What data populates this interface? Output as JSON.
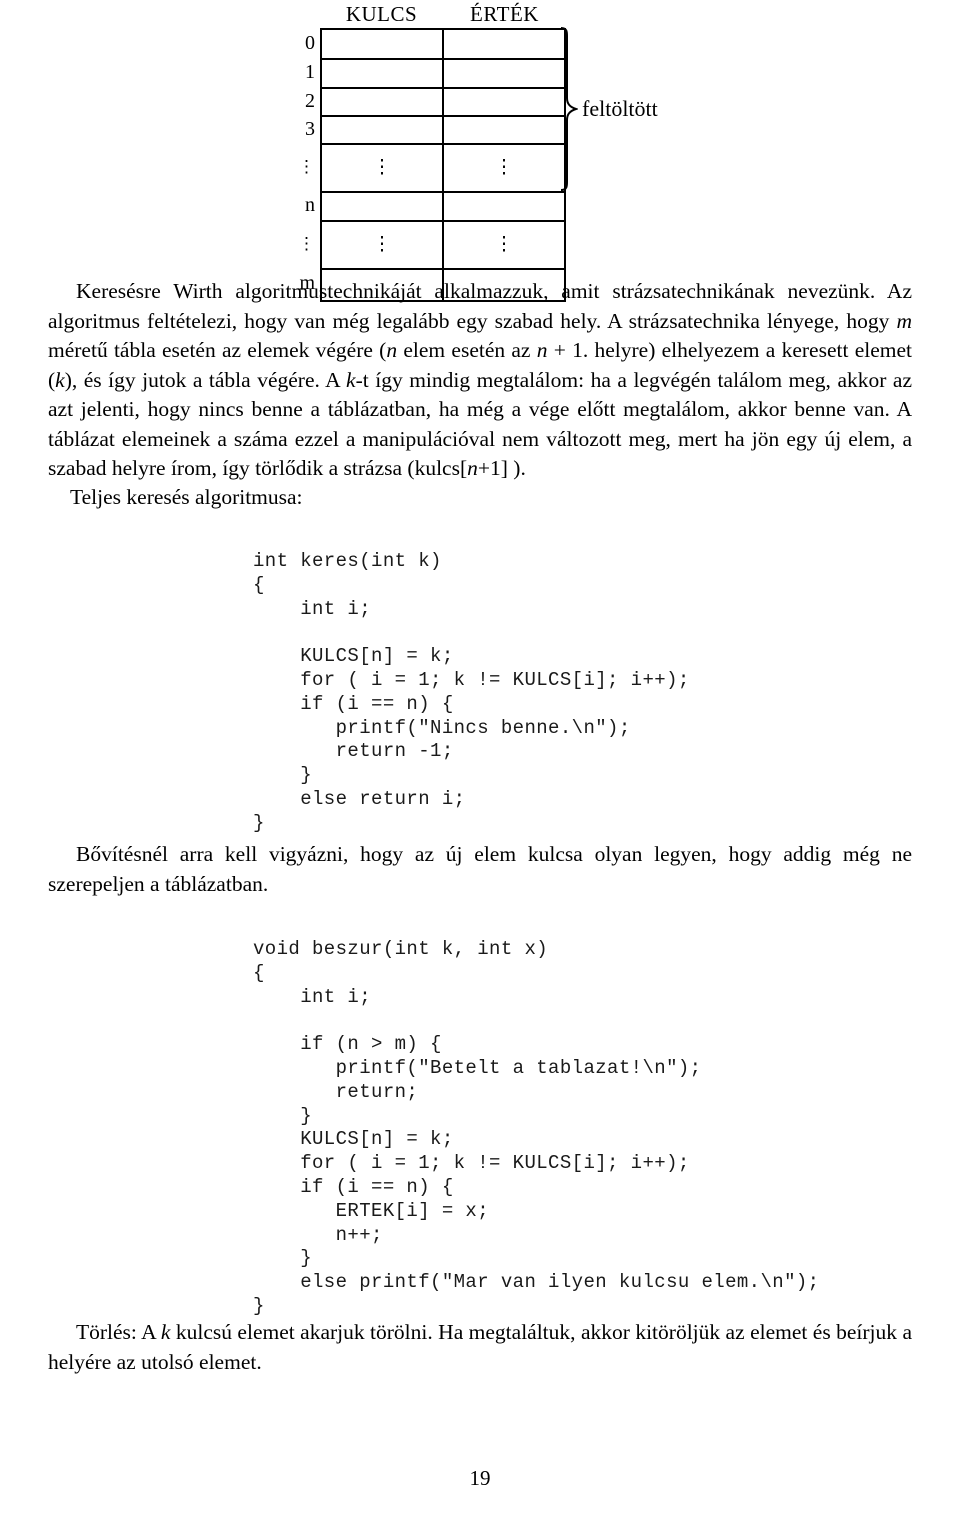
{
  "figure": {
    "column_headers": [
      "KULCS",
      "ÉRTÉK"
    ],
    "row_labels": [
      "0",
      "1",
      "2",
      "3",
      "⋮",
      "n",
      "⋮",
      "m"
    ],
    "cell_marks": [
      "",
      "",
      "",
      "",
      "⋮",
      "",
      "⋮",
      ""
    ],
    "brace_label": "feltöltött",
    "brace_icon": "right-curly-brace-icon"
  },
  "paragraphs": {
    "intro_html": "Keresésre Wirth algoritmustechnikáját alkalmazzuk, amit strázsatechnikának nevezünk. Az algoritmus feltételezi, hogy van még legalább egy szabad hely. A strázsatechnika lényege, hogy <i>m</i> méretű tábla esetén az elemek végére (<i>n</i> elem esetén az <i>n</i> + 1. helyre) elhelyezem a keresett elemet (<i>k</i>), és így jutok a tábla végére. A <i>k</i>-t így mindig megtalálom: ha a legvégén találom meg, akkor az azt jelenti, hogy nincs benne a táblázatban, ha még a vége előtt megtalálom, akkor benne van. A táblázat elemeinek a száma ezzel a manipulációval nem változott meg, mert ha jön egy új elem, a szabad helyre írom, így törlődik a strázsa (kulcs[<i>n</i>+1] ).",
    "teljes_html": "Teljes keresés algoritmusa:",
    "bovites_html": "Bővítésnél arra kell vigyázni, hogy az új elem kulcsa olyan legyen, hogy addig még ne szerepeljen a táblázatban.",
    "torles_html": "Törlés: A <i>k</i> kulcsú elemet akarjuk törölni. Ha megtaláltuk, akkor kitöröljük az elemet és beírjuk a helyére az utolsó elemet."
  },
  "code_blocks": {
    "keres": "int keres(int k)\n{\n    int i;\n\n    KULCS[n] = k;\n    for ( i = 1; k != KULCS[i]; i++);\n    if (i == n) {\n       printf(\"Nincs benne.\\n\");\n       return -1;\n    }\n    else return i;\n}",
    "beszur": "void beszur(int k, int x)\n{\n    int i;\n\n    if (n > m) {\n       printf(\"Betelt a tablazat!\\n\");\n       return;\n    }\n    KULCS[n] = k;\n    for ( i = 1; k != KULCS[i]; i++);\n    if (i == n) {\n       ERTEK[i] = x;\n       n++;\n    }\n    else printf(\"Mar van ilyen kulcsu elem.\\n\");\n}"
  },
  "footer": {
    "page_number": "19"
  },
  "colors": {
    "text": "#000000",
    "code_text": "#1a1a1a",
    "rule": "#000000",
    "background": "#ffffff"
  }
}
